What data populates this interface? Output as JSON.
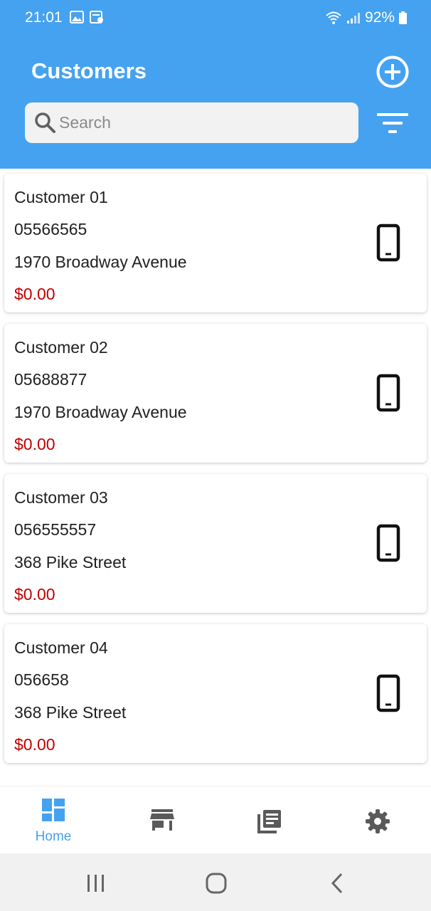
{
  "status_bar": {
    "time": "21:01",
    "battery": "92%"
  },
  "header": {
    "title": "Customers",
    "add_icon": "plus-circle-icon",
    "filter_icon": "filter-icon"
  },
  "search": {
    "placeholder": "Search",
    "value": ""
  },
  "customers": [
    {
      "name": "Customer 01",
      "phone": "05566565",
      "address": "1970 Broadway Avenue",
      "balance": "$0.00"
    },
    {
      "name": "Customer 02",
      "phone": "05688877",
      "address": "1970 Broadway Avenue",
      "balance": "$0.00"
    },
    {
      "name": "Customer 03",
      "phone": "056555557",
      "address": "368 Pike Street",
      "balance": "$0.00"
    },
    {
      "name": "Customer 04",
      "phone": "056658",
      "address": "368 Pike Street",
      "balance": "$0.00"
    }
  ],
  "bottom_nav": {
    "items": [
      {
        "label": "Home",
        "icon": "dashboard-icon",
        "active": true
      },
      {
        "label": "",
        "icon": "store-icon",
        "active": false
      },
      {
        "label": "",
        "icon": "library-books-icon",
        "active": false
      },
      {
        "label": "",
        "icon": "settings-gear-icon",
        "active": false
      }
    ]
  },
  "colors": {
    "primary": "#45a2f0",
    "balance": "#c00000",
    "nav_inactive": "#5a5a5a"
  }
}
